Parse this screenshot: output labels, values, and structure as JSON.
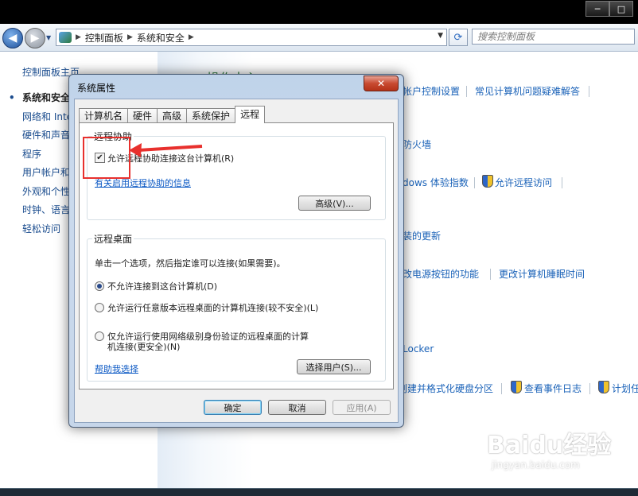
{
  "window": {
    "minimize": "─",
    "maximize": "□"
  },
  "address": {
    "segments": [
      "控制面板",
      "系统和安全"
    ],
    "search_placeholder": "搜索控制面板"
  },
  "leftnav": {
    "home": "控制面板主页",
    "items": [
      "系统和安全",
      "网络和 Inte",
      "硬件和声音",
      "程序",
      "用户帐户和",
      "外观和个性",
      "时钟、语言",
      "轻松访问"
    ]
  },
  "content": {
    "heading": "操作中心",
    "links": {
      "uac": "帐户控制设置",
      "troubleshoot": "常见计算机问题疑难解答",
      "firewall": "防火墙",
      "wei": "dows 体验指数",
      "allow_remote": "允许远程访问",
      "updates": "装的更新",
      "power_buttons": "改电源按钮的功能",
      "sleep": "更改计算机睡眠时间",
      "bitlocker": "Locker",
      "partition": "创建并格式化硬盘分区",
      "event_log": "查看事件日志",
      "tasks": "计划任"
    }
  },
  "dialog": {
    "title": "系统属性",
    "close": "✕",
    "tabs": [
      {
        "label": "计算机名",
        "active": false
      },
      {
        "label": "硬件",
        "active": false
      },
      {
        "label": "高级",
        "active": false
      },
      {
        "label": "系统保护",
        "active": false
      },
      {
        "label": "远程",
        "active": true
      }
    ],
    "remote_assistance": {
      "group_label": "远程协助",
      "checkbox_label": "允许远程协助连接这台计算机(R)",
      "checked": true,
      "info_link": "有关启用远程协助的信息",
      "advanced_button": "高级(V)..."
    },
    "remote_desktop": {
      "group_label": "远程桌面",
      "instruction": "单击一个选项，然后指定谁可以连接(如果需要)。",
      "options": [
        {
          "label": "不允许连接到这台计算机(D)",
          "selected": true
        },
        {
          "label": "允许运行任意版本远程桌面的计算机连接(较不安全)(L)",
          "selected": false
        },
        {
          "label_line1": "仅允许运行使用网络级别身份验证的远程桌面的计算",
          "label_line2": "机连接(更安全)(N)",
          "selected": false
        }
      ],
      "help_link": "帮助我选择",
      "select_users_button": "选择用户(S)..."
    },
    "buttons": {
      "ok": "确定",
      "cancel": "取消",
      "apply": "应用(A)"
    }
  },
  "watermark": {
    "main": "Baidu经验",
    "sub": "jingyan.baidu.com"
  },
  "colors": {
    "annotation": "#e8302d",
    "link": "#0a58c4",
    "title_heading": "#2a7a3b"
  }
}
